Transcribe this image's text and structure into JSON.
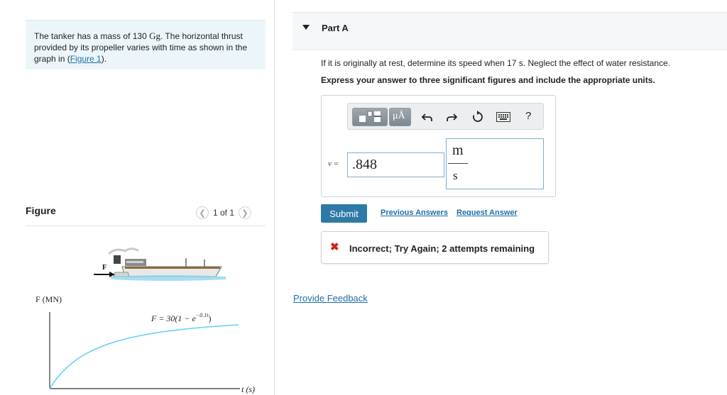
{
  "problem": {
    "text_before_mass": "The tanker has a mass of 130 ",
    "mass_unit": "Gg",
    "text_after_mass": ". The horizontal thrust provided by its propeller varies with time as shown in the graph in (",
    "figure_link": "Figure 1",
    "text_end": ")."
  },
  "figure": {
    "title": "Figure",
    "pager_text": "1 of 1",
    "force_label": "F",
    "y_axis_label": "F (MN)",
    "x_axis_label": "t (s)",
    "equation": "F = 30(1 − e",
    "equation_exponent": "−0.1t",
    "equation_close": ")"
  },
  "part_a": {
    "label": "Part A",
    "question": "If it is originally at rest, determine its speed when 17 s. Neglect the effect of water resistance.",
    "instruction": "Express your answer to three significant figures and include the appropriate units.",
    "toolbar": {
      "units_label": "μÅ",
      "help_label": "?",
      "icons": [
        "templates-icon",
        "units-icon",
        "undo-icon",
        "redo-icon",
        "reset-icon",
        "keyboard-icon",
        "help-icon"
      ]
    },
    "variable_label": "v =",
    "answer_value": ".848",
    "units_numerator": "m",
    "units_denominator": "s",
    "submit_label": "Submit",
    "previous_answers": "Previous Answers",
    "request_answer": "Request Answer",
    "feedback": "Incorrect; Try Again; 2 attempts remaining",
    "feedback_color": "#d4211b"
  },
  "provide_feedback": "Provide Feedback",
  "colors": {
    "accent": "#2e79a6",
    "link": "#1f6fa9",
    "curve": "#5fd3f3",
    "problem_bg": "#ecf6fa"
  }
}
